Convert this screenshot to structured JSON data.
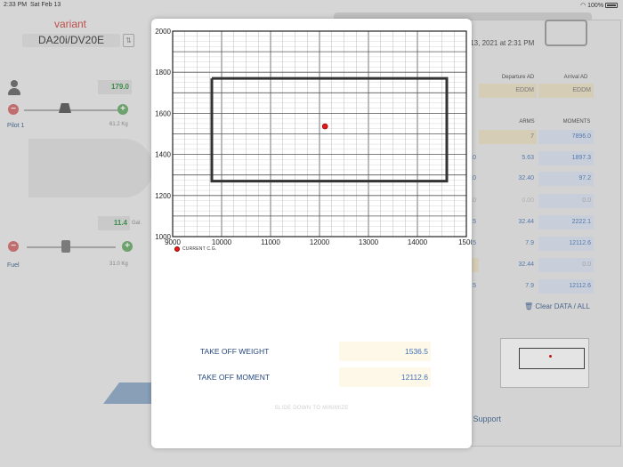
{
  "status_bar": {
    "time": "2:33 PM",
    "date": "Sat Feb 13",
    "battery": "100%"
  },
  "background": {
    "variant_label": "variant",
    "model": "DA20i/DV20E",
    "pilot": {
      "label": "Pilot 1",
      "value": "179.0",
      "scale": "61.2 Kg"
    },
    "fuel": {
      "label": "Fuel",
      "value": "11.4",
      "unit": "Gal.",
      "scale": "31.0 Kg"
    },
    "clipboard": {
      "date_partial": "y 13, 2021 at 2:31 PM",
      "headers": {
        "departure": "Departure AD",
        "arrival": "Arrival AD",
        "arms": "ARMS",
        "moments": "MOMENTS"
      },
      "departure_ad": "EDDM",
      "arrival_ad": "EDDM",
      "rows": [
        {
          "arms": "7",
          "moments": "7896.0"
        },
        {
          "arms": "5.63",
          "moments": "1897.3"
        },
        {
          "arms": "32.40",
          "moments": "97.2"
        },
        {
          "arms": "0.00",
          "moments": "0.0"
        },
        {
          "arms": "32.44",
          "moments": "2222.1"
        },
        {
          "arms": "7.9",
          "moments": "12112.6"
        },
        {
          "arms": "32.44",
          "moments": "0.0"
        },
        {
          "arms": "7.9",
          "moments": "12112.6"
        }
      ],
      "left_partial": [
        ".0",
        ".0",
        ".0",
        ".5",
        ".5",
        ".5"
      ],
      "clear_label": "Clear DATA / ALL",
      "support_partial": "ail Support"
    }
  },
  "modal": {
    "legend": "CURRENT C.G.",
    "results": [
      {
        "label": "TAKE OFF WEIGHT",
        "value": "1536.5"
      },
      {
        "label": "TAKE OFF MOMENT",
        "value": "12112.6"
      }
    ],
    "hint": "SLIDE DOWN TO MINIMIZE"
  },
  "chart_data": {
    "type": "scatter",
    "title": "",
    "xlabel": "",
    "ylabel": "",
    "xlim": [
      9000,
      15000
    ],
    "ylim": [
      1000,
      2000
    ],
    "x_ticks": [
      9000,
      10000,
      11000,
      12000,
      13000,
      14000,
      15000
    ],
    "x_tick_labels": [
      "9000",
      "10000",
      "11000",
      "12000",
      "13000",
      "14000",
      "1500"
    ],
    "y_ticks": [
      1000,
      1200,
      1400,
      1600,
      1800,
      2000
    ],
    "grid": true,
    "envelope": {
      "x": [
        9800,
        14600,
        14600,
        9800,
        9800
      ],
      "y": [
        1770,
        1770,
        1270,
        1270,
        1770
      ]
    },
    "series": [
      {
        "name": "CURRENT C.G.",
        "x": [
          12112.6
        ],
        "y": [
          1536.5
        ],
        "color": "#e01a1a"
      }
    ],
    "legend": "bottom-left"
  }
}
